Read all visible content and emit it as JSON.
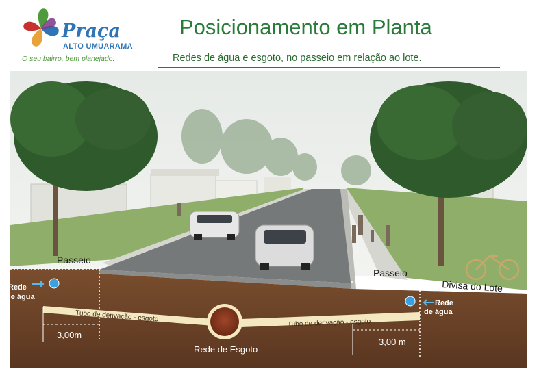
{
  "logo": {
    "name": "Praça",
    "subname": "ALTO UMUARAMA",
    "tagline": "O seu bairro, bem planejado."
  },
  "header": {
    "title": "Posicionamento em Planta",
    "subtitle": "Redes de água e esgoto, no passeio em relação ao lote."
  },
  "diagram": {
    "passeio_left": "Passeio",
    "passeio_right": "Passeio",
    "divisa": "Divisa do Lote",
    "rede_agua_left_1": "Rede",
    "rede_agua_left_2": "de água",
    "rede_agua_right_1": "Rede",
    "rede_agua_right_2": "de água",
    "tubo_left": "Tubo de derivação - esgoto",
    "tubo_right": "Tubo de derivação - esgoto",
    "rede_esgoto": "Rede de Esgoto",
    "dim_left": "3,00m",
    "dim_right": "3,00 m"
  },
  "colors": {
    "title_green": "#2a7a3a",
    "logo_blue": "#2f74b4",
    "soil": "#6b4226",
    "pipe": "#f4e8c0",
    "sewer": "#8a3a1c",
    "water": "#3aa0e0"
  }
}
